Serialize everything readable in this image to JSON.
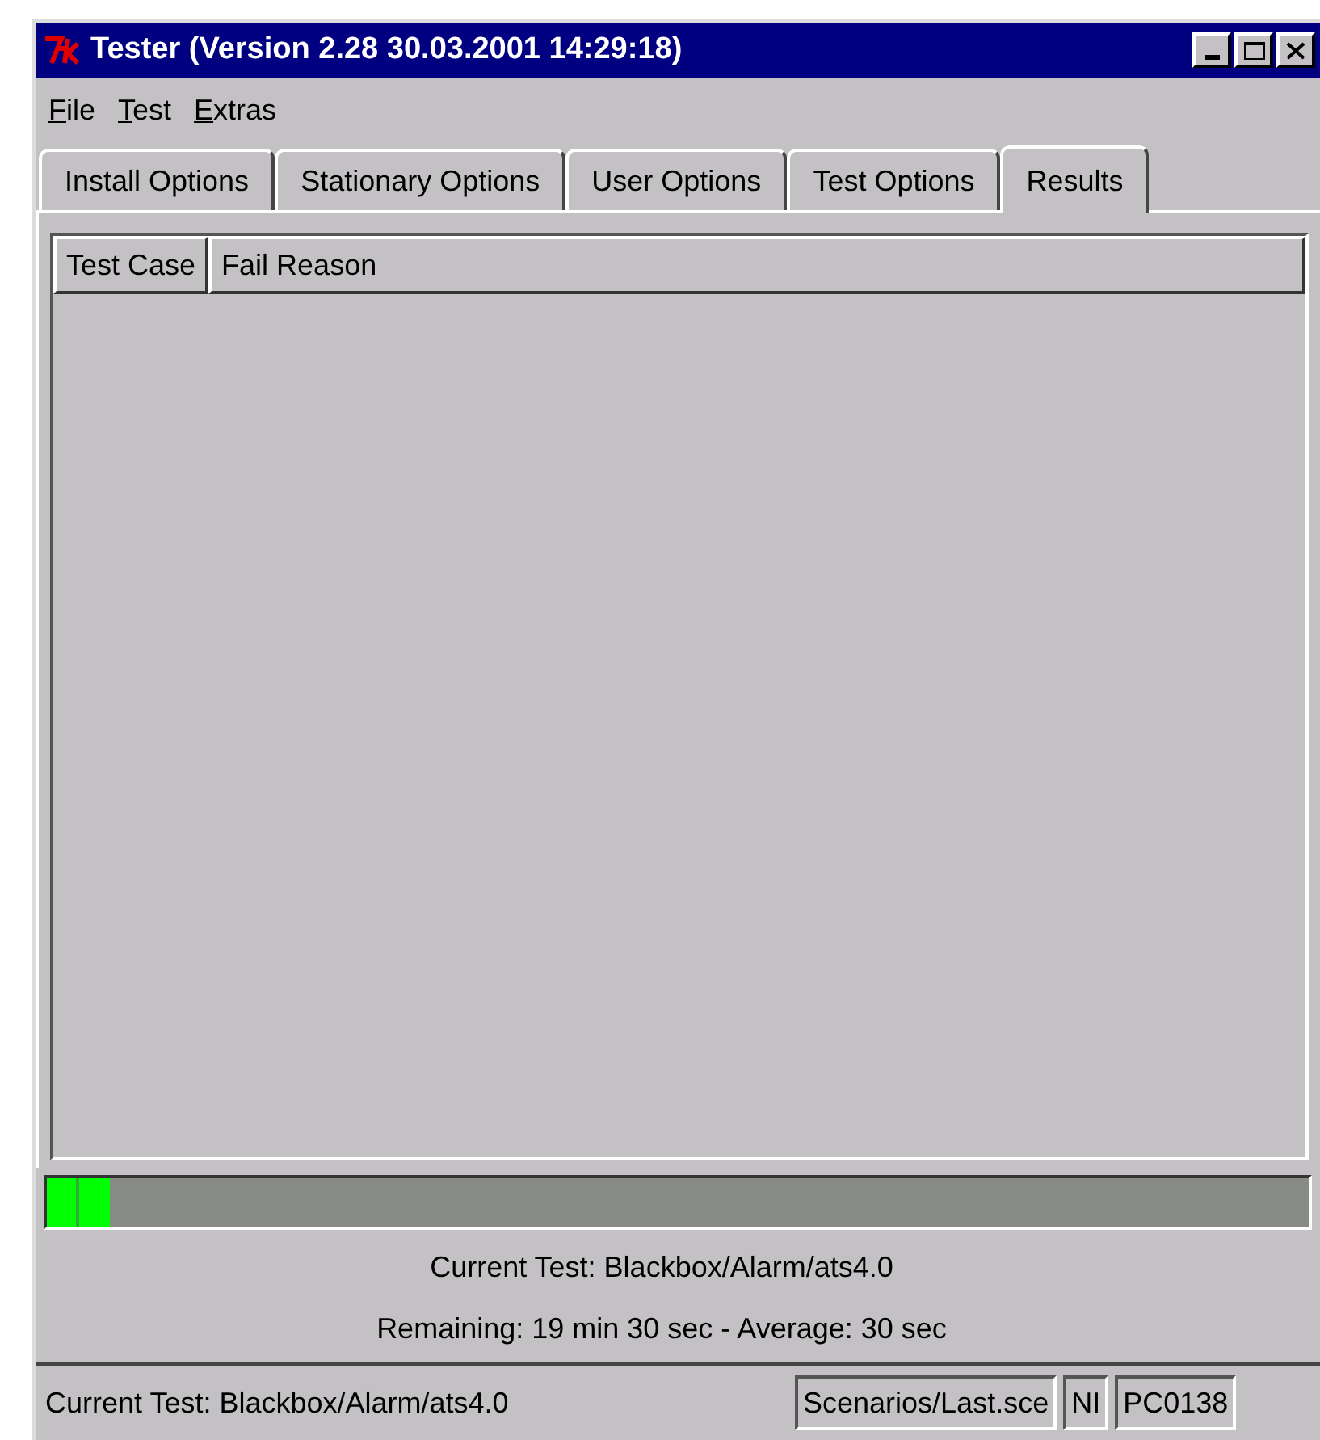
{
  "window": {
    "title": "Tester (Version 2.28 30.03.2001 14:29:18)"
  },
  "menu": [
    {
      "label": "File"
    },
    {
      "label": "Test"
    },
    {
      "label": "Extras"
    }
  ],
  "tabs": [
    {
      "label": "Install Options",
      "selected": false
    },
    {
      "label": "Stationary Options",
      "selected": false
    },
    {
      "label": "User Options",
      "selected": false
    },
    {
      "label": "Test Options",
      "selected": false
    },
    {
      "label": "Results",
      "selected": true
    }
  ],
  "table": {
    "columns": [
      "Test Case",
      "Fail Reason"
    ]
  },
  "progress": {
    "level": 0.05
  },
  "info_lines": [
    "Current Test: Blackbox/Alarm/ats4.0",
    "Remaining: 19 min 30 sec - Average: 30 sec"
  ],
  "status_bar": {
    "message": "Current Test: Blackbox/Alarm/ats4.0",
    "fields": [
      "Scenarios/Last.sce",
      "NI",
      "PC0138"
    ]
  }
}
